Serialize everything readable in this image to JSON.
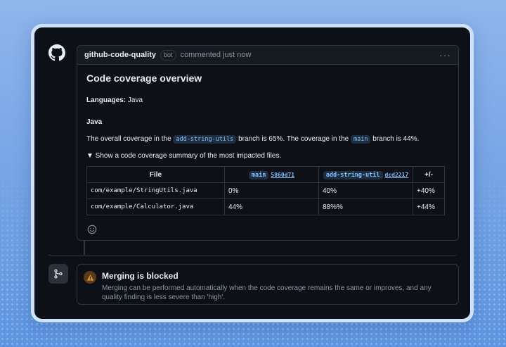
{
  "comment": {
    "author": "github-code-quality",
    "badge": "bot",
    "meta": "commented just now",
    "menu": "···"
  },
  "report": {
    "title": "Code coverage overview",
    "languages_label": "Languages:",
    "languages_value": " Java",
    "section_title": "Java",
    "para_1": "The overall coverage in the",
    "branch_head": "add-string-utils",
    "para_2": "branch is 65%. The coverage in the",
    "branch_base": "main",
    "para_3": "branch is 44%.",
    "summary": "▼ Show a code coverage summary of the most impacted files."
  },
  "table": {
    "col_file": "File",
    "col_main_branch": "main",
    "col_main_sha": "5860d71",
    "col_head_branch": "add-string-util",
    "col_head_sha": "dcd2217",
    "col_delta": "+/-",
    "rows": [
      {
        "file": "com/example/StringUtils.java",
        "main": "0%",
        "head": "40%",
        "delta": "+40%"
      },
      {
        "file": "com/example/Calculator.java",
        "main": "44%",
        "head": "88%%",
        "delta": "+44%"
      }
    ]
  },
  "merge": {
    "title": "Merging is blocked",
    "description": "Merging can be performed automatically when the code coverage remains the same or improves, and any quality finding is less severe than 'high'."
  },
  "colors": {
    "background": "#0d1117",
    "border": "#30363d",
    "link": "#79c0ff",
    "muted": "#8b949e",
    "warning": "#d29922"
  },
  "icons": [
    "github-logo-icon",
    "kebab-menu-icon",
    "smiley-icon",
    "git-branch-icon",
    "warning-icon"
  ]
}
